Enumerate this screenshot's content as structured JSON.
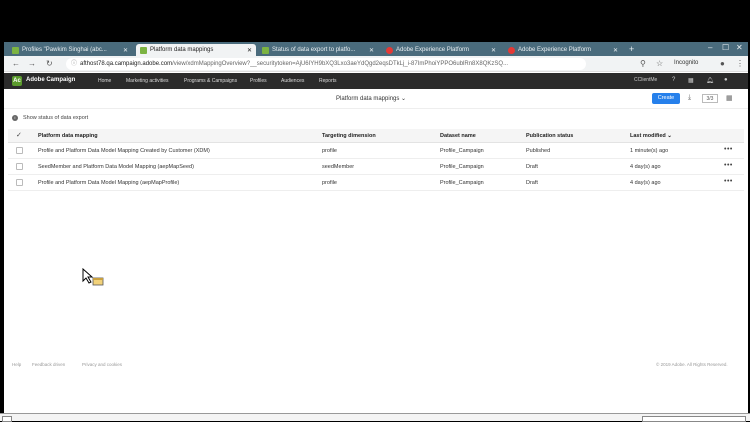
{
  "browser": {
    "tabs": [
      {
        "label": "Profiles \"Pawkim Singhai (abc...",
        "active": false,
        "favicon": "#7cb342"
      },
      {
        "label": "Platform data mappings",
        "active": true,
        "favicon": "#7cb342"
      },
      {
        "label": "Status of data export to platfo...",
        "active": false,
        "favicon": "#7cb342"
      },
      {
        "label": "Adobe Experience Platform",
        "active": false,
        "favicon": "#e53935"
      },
      {
        "label": "Adobe Experience Platform",
        "active": false,
        "favicon": "#e53935"
      }
    ],
    "url_host": "afthost78.qa.campaign.adobe.com",
    "url_path": "/view/xdmMappingOverview?__securitytoken=AjU6IYH9bXQ3Lxo3aeYdQgd2eqsDTkLj_i-87ImPhoiYPPO6ublRn8X8QKzSQ...",
    "profile": "Incognito"
  },
  "app": {
    "brand": "Adobe Campaign",
    "menu": [
      "Home",
      "Marketing activities",
      "Programs & Campaigns",
      "Profiles",
      "Audiences",
      "Reports"
    ],
    "user": "CClientMe"
  },
  "toolbar": {
    "title": "Platform data mappings",
    "create_label": "Create",
    "count": "3/3"
  },
  "status_link": "Show status of data export",
  "table": {
    "headers": [
      "Platform data mapping",
      "Targeting dimension",
      "Dataset name",
      "Publication status",
      "Last modified"
    ],
    "rows": [
      [
        "Profile and Platform Data Model Mapping Created by Customer (XDM)",
        "profile",
        "Profile_Campaign",
        "Published",
        "1 minute(s) ago"
      ],
      [
        "SeedMember and Platform Data Model Mapping (aepMapSeed)",
        "seedMember",
        "Profile_Campaign",
        "Draft",
        "4 day(s) ago"
      ],
      [
        "Profile and Platform Data Model Mapping (aepMapProfile)",
        "profile",
        "Profile_Campaign",
        "Draft",
        "4 day(s) ago"
      ]
    ]
  },
  "footer": {
    "links": [
      "Help",
      "Feedback driven",
      "Privacy and cookies"
    ],
    "copyright": "© 2019 Adobe. All Rights Reserved."
  }
}
